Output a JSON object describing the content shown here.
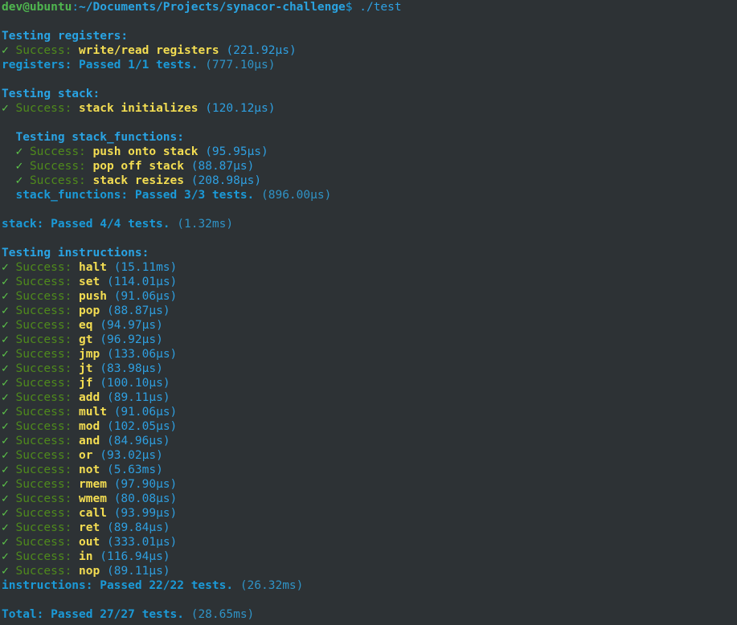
{
  "terminal": {
    "background": "#2d3235",
    "prompt": {
      "user_host": "dev@ubuntu",
      "separator": ":",
      "path": "~/Documents/Projects/synacor-challenge",
      "dollar": "$",
      "command": " ./test"
    },
    "labels": {
      "success_prefix": "Success:",
      "check_glyph": "✓",
      "testing_prefix": "Testing ",
      "colon": ":",
      "passed_word": "Passed",
      "tests_word": "tests."
    },
    "suites": [
      {
        "name": "registers",
        "header": "Testing registers:",
        "indent": 0,
        "tests": [
          {
            "name": "write/read registers",
            "time": "(221.92µs)"
          }
        ],
        "summary": "registers: Passed 1/1 tests.",
        "summary_time": "(777.10µs)",
        "passed": 1,
        "total": 1
      },
      {
        "name": "stack",
        "header": "Testing stack:",
        "indent": 0,
        "tests": [
          {
            "name": "stack initializes",
            "time": "(120.12µs)"
          }
        ],
        "nested": {
          "name": "stack_functions",
          "header": "Testing stack_functions:",
          "indent": 2,
          "tests": [
            {
              "name": "push onto stack",
              "time": "(95.95µs)"
            },
            {
              "name": "pop off stack",
              "time": "(88.87µs)"
            },
            {
              "name": "stack resizes",
              "time": "(208.98µs)"
            }
          ],
          "summary": "stack_functions: Passed 3/3 tests.",
          "summary_time": "(896.00µs)",
          "passed": 3,
          "total": 3
        },
        "summary": "stack: Passed 4/4 tests.",
        "summary_time": "(1.32ms)",
        "passed": 4,
        "total": 4
      },
      {
        "name": "instructions",
        "header": "Testing instructions:",
        "indent": 0,
        "tests": [
          {
            "name": "halt",
            "time": "(15.11ms)"
          },
          {
            "name": "set",
            "time": "(114.01µs)"
          },
          {
            "name": "push",
            "time": "(91.06µs)"
          },
          {
            "name": "pop",
            "time": "(88.87µs)"
          },
          {
            "name": "eq",
            "time": "(94.97µs)"
          },
          {
            "name": "gt",
            "time": "(96.92µs)"
          },
          {
            "name": "jmp",
            "time": "(133.06µs)"
          },
          {
            "name": "jt",
            "time": "(83.98µs)"
          },
          {
            "name": "jf",
            "time": "(100.10µs)"
          },
          {
            "name": "add",
            "time": "(89.11µs)"
          },
          {
            "name": "mult",
            "time": "(91.06µs)"
          },
          {
            "name": "mod",
            "time": "(102.05µs)"
          },
          {
            "name": "and",
            "time": "(84.96µs)"
          },
          {
            "name": "or",
            "time": "(93.02µs)"
          },
          {
            "name": "not",
            "time": "(5.63ms)"
          },
          {
            "name": "rmem",
            "time": "(97.90µs)"
          },
          {
            "name": "wmem",
            "time": "(80.08µs)"
          },
          {
            "name": "call",
            "time": "(93.99µs)"
          },
          {
            "name": "ret",
            "time": "(89.84µs)"
          },
          {
            "name": "out",
            "time": "(333.01µs)"
          },
          {
            "name": "in",
            "time": "(116.94µs)"
          },
          {
            "name": "nop",
            "time": "(89.11µs)"
          }
        ],
        "summary": "instructions: Passed 22/22 tests.",
        "summary_time": "(26.32ms)",
        "passed": 22,
        "total": 22
      }
    ],
    "total": {
      "summary": "Total: Passed 27/27 tests.",
      "summary_time": "(28.65ms)",
      "passed": 27,
      "total": 27
    }
  }
}
